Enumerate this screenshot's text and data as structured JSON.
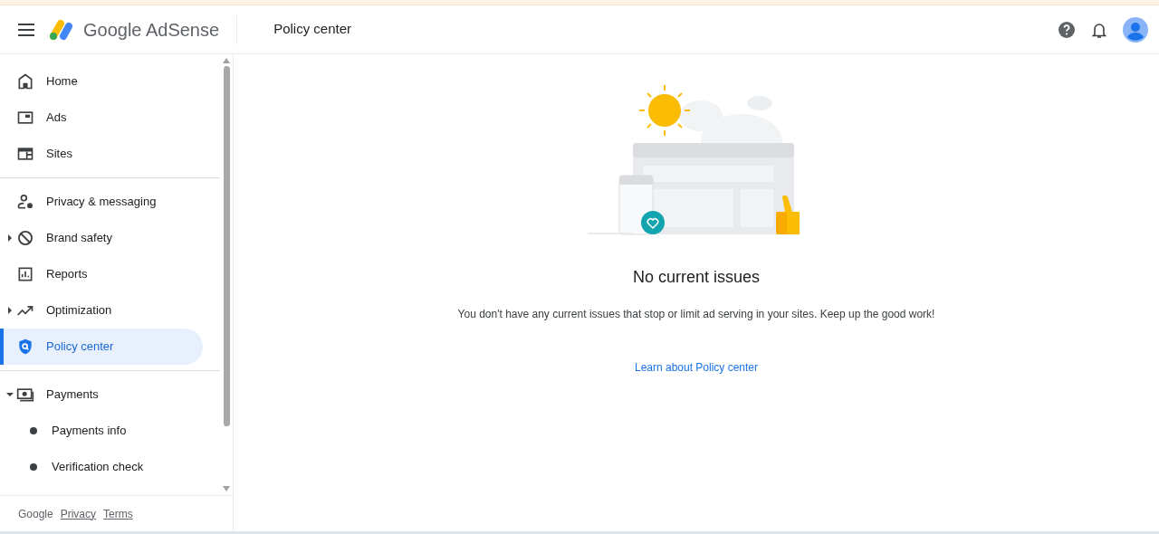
{
  "header": {
    "product": "Google AdSense",
    "page_title": "Policy center"
  },
  "nav_sections": [
    {
      "items": [
        {
          "label": "Home",
          "selected": false
        },
        {
          "label": "Ads",
          "selected": false
        },
        {
          "label": "Sites",
          "selected": false
        }
      ]
    },
    {
      "items": [
        {
          "label": "Privacy & messaging",
          "selected": false
        },
        {
          "label": "Brand safety",
          "selected": false,
          "expanded": false
        },
        {
          "label": "Reports",
          "selected": false
        },
        {
          "label": "Optimization",
          "selected": false,
          "expanded": false
        },
        {
          "label": "Policy center",
          "selected": true
        }
      ]
    },
    {
      "items": [
        {
          "label": "Payments",
          "selected": false,
          "expanded": true,
          "children": [
            {
              "label": "Payments info",
              "selected": false
            },
            {
              "label": "Verification check",
              "selected": false
            }
          ]
        }
      ]
    }
  ],
  "footer": {
    "brand": "Google",
    "links": [
      "Privacy",
      "Terms"
    ]
  },
  "main": {
    "title": "No current issues",
    "message": "You don't have any current issues that stop or limit ad serving in your sites. Keep up the good work!",
    "link": "Learn about Policy center"
  }
}
